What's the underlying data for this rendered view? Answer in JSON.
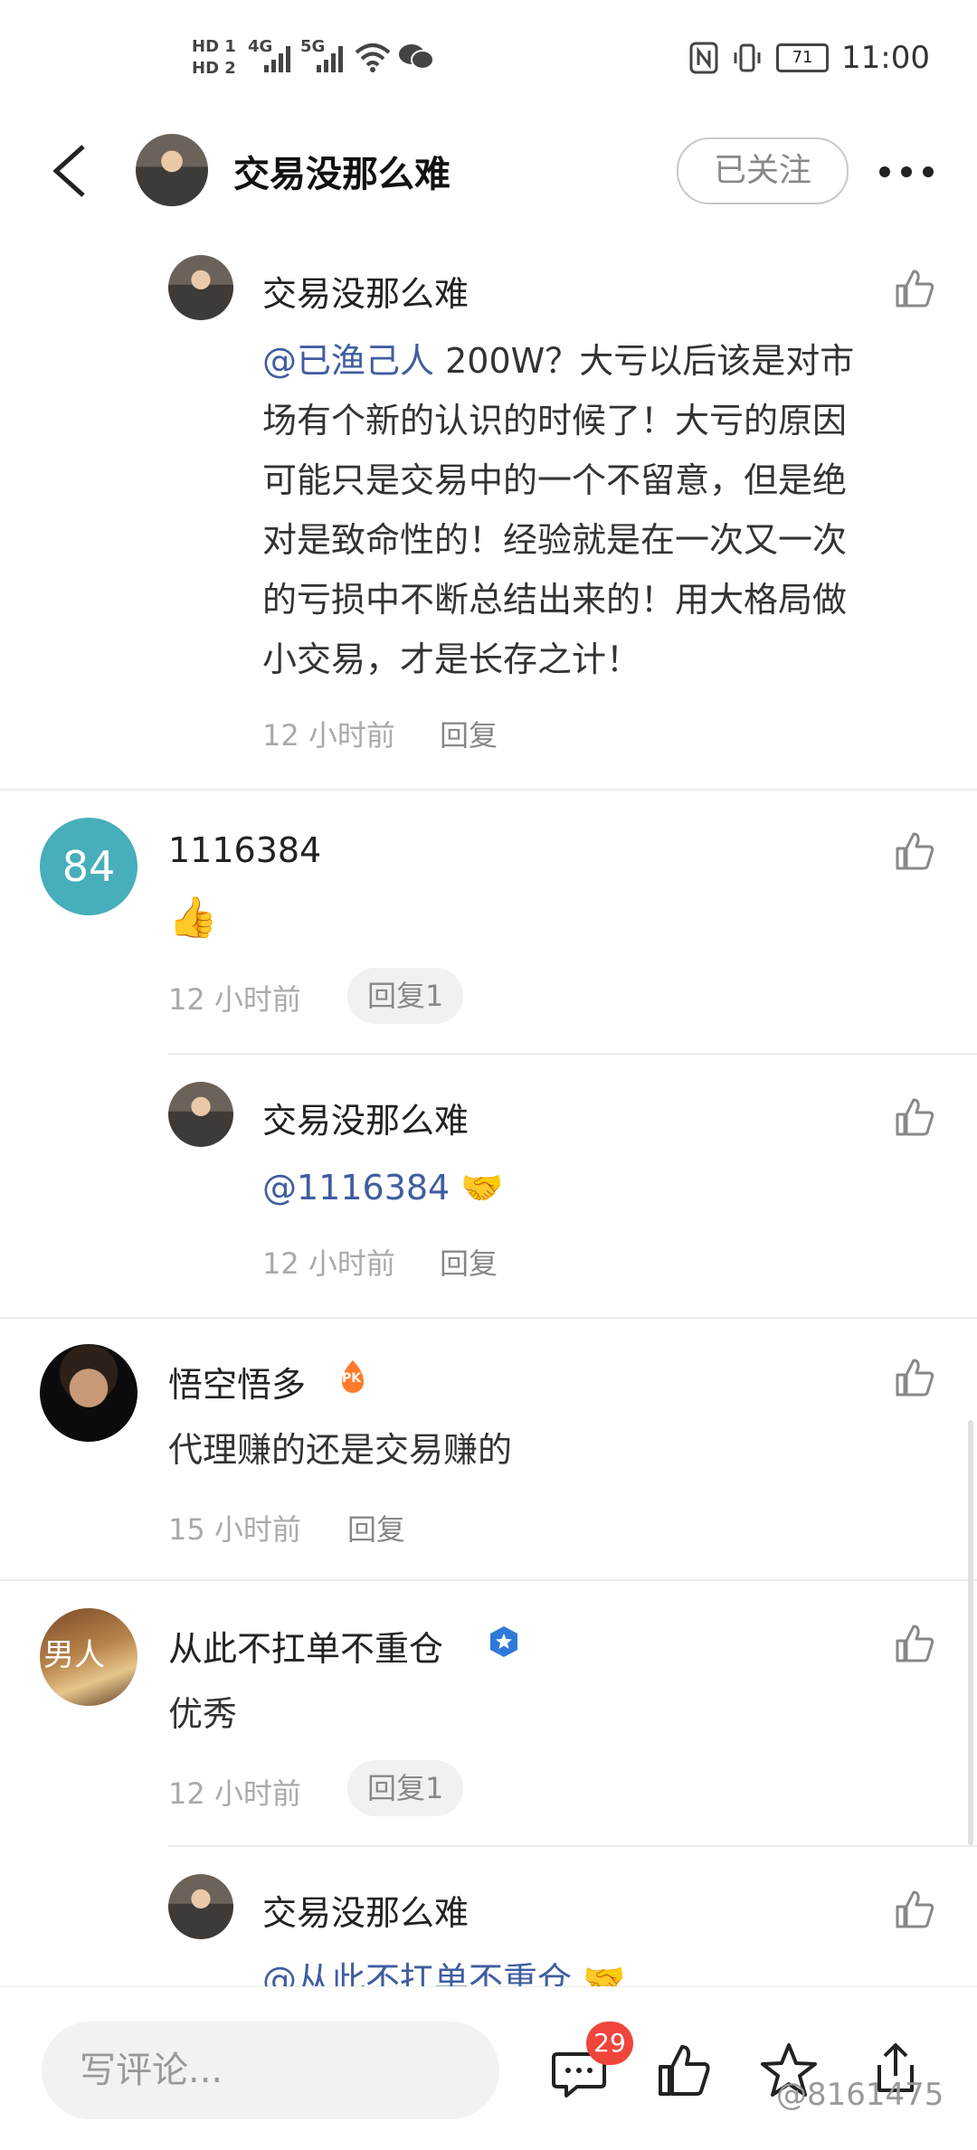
{
  "status_bar": {
    "hd1": "HD 1",
    "hd2": "HD 2",
    "net1": "4G",
    "net2": "5G",
    "battery": "71",
    "time": "11:00"
  },
  "header": {
    "title": "交易没那么难",
    "follow_label": "已关注"
  },
  "comments": [
    {
      "author": "交易没那么难",
      "mention": "@已渔己人",
      "text_line1": " 200W？大亏以后该是对市",
      "text_lines": [
        "场有个新的认识的时候了！大亏的原因",
        "可能只是交易中的一个不留意，但是绝",
        "对是致命性的！经验就是在一次又一次",
        "的亏损中不断总结出来的！用大格局做",
        "小交易，才是长存之计！"
      ],
      "time": "12 小时前",
      "reply": "回复"
    },
    {
      "author": "1116384",
      "avatar_text": "84",
      "emoji": "👍",
      "time": "12 小时前",
      "reply": "回复1"
    },
    {
      "author": "交易没那么难",
      "mention": "@1116384",
      "emoji": "🤝",
      "time": "12 小时前",
      "reply": "回复"
    },
    {
      "author": "悟空悟多",
      "badge": "PK",
      "text": "代理赚的还是交易赚的",
      "time": "15 小时前",
      "reply": "回复"
    },
    {
      "author": "从此不扛单不重仓",
      "avatar_text": "男人",
      "text": "优秀",
      "time": "12 小时前",
      "reply": "回复1"
    },
    {
      "author": "交易没那么难",
      "mention": "@从此不扛单不重仓",
      "emoji": "🤝"
    }
  ],
  "bottom_bar": {
    "placeholder": "写评论...",
    "comment_count": "29",
    "watermark": "@8161475"
  },
  "colors": {
    "mention": "#3f5da0",
    "badge": "#f0453c",
    "avatar_84": "#47aebb"
  }
}
